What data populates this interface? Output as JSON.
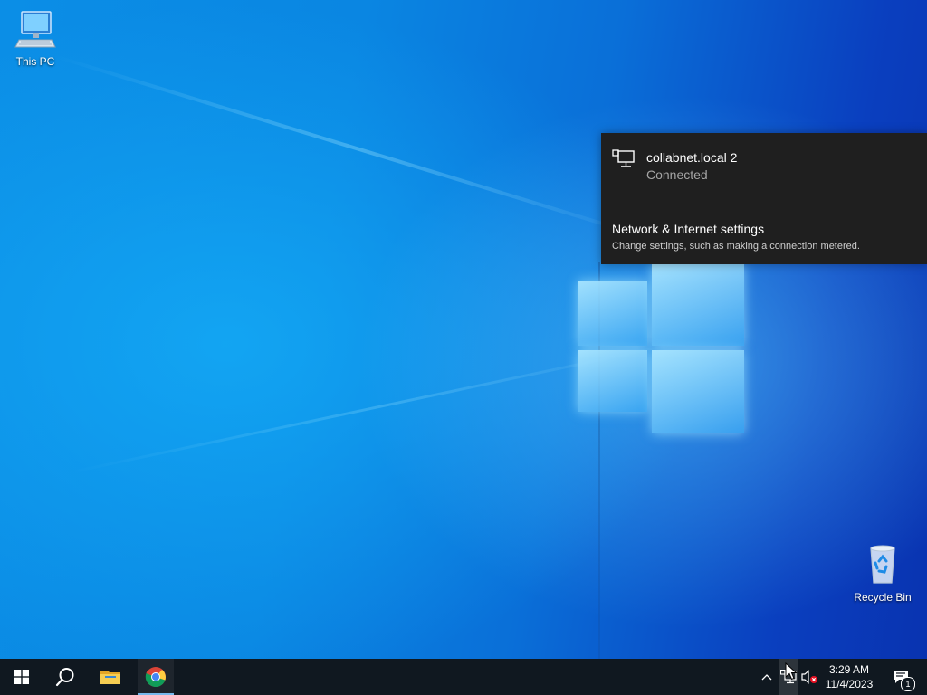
{
  "desktop": {
    "icons": [
      {
        "label": "This PC",
        "icon": "computer-icon"
      },
      {
        "label": "Recycle Bin",
        "icon": "recycle-bin-icon"
      }
    ]
  },
  "network_flyout": {
    "network_icon": "wired-network-icon",
    "network_name": "collabnet.local 2",
    "status": "Connected",
    "settings_link": "Network & Internet settings",
    "settings_desc": "Change settings, such as making a connection metered."
  },
  "taskbar": {
    "pinned": [
      {
        "name": "start",
        "icon": "windows-icon"
      },
      {
        "name": "search",
        "icon": "search-icon"
      },
      {
        "name": "file-explorer",
        "icon": "folder-icon"
      },
      {
        "name": "chrome",
        "icon": "chrome-icon",
        "active": true
      }
    ],
    "tray": {
      "time": "3:29 AM",
      "date": "11/4/2023",
      "notification_count": "1"
    }
  },
  "colors": {
    "flyout_bg": "#1f1f1f",
    "taskbar_bg": "#101820",
    "accent": "#76b9ed",
    "muted_text": "#a6a6a6"
  }
}
